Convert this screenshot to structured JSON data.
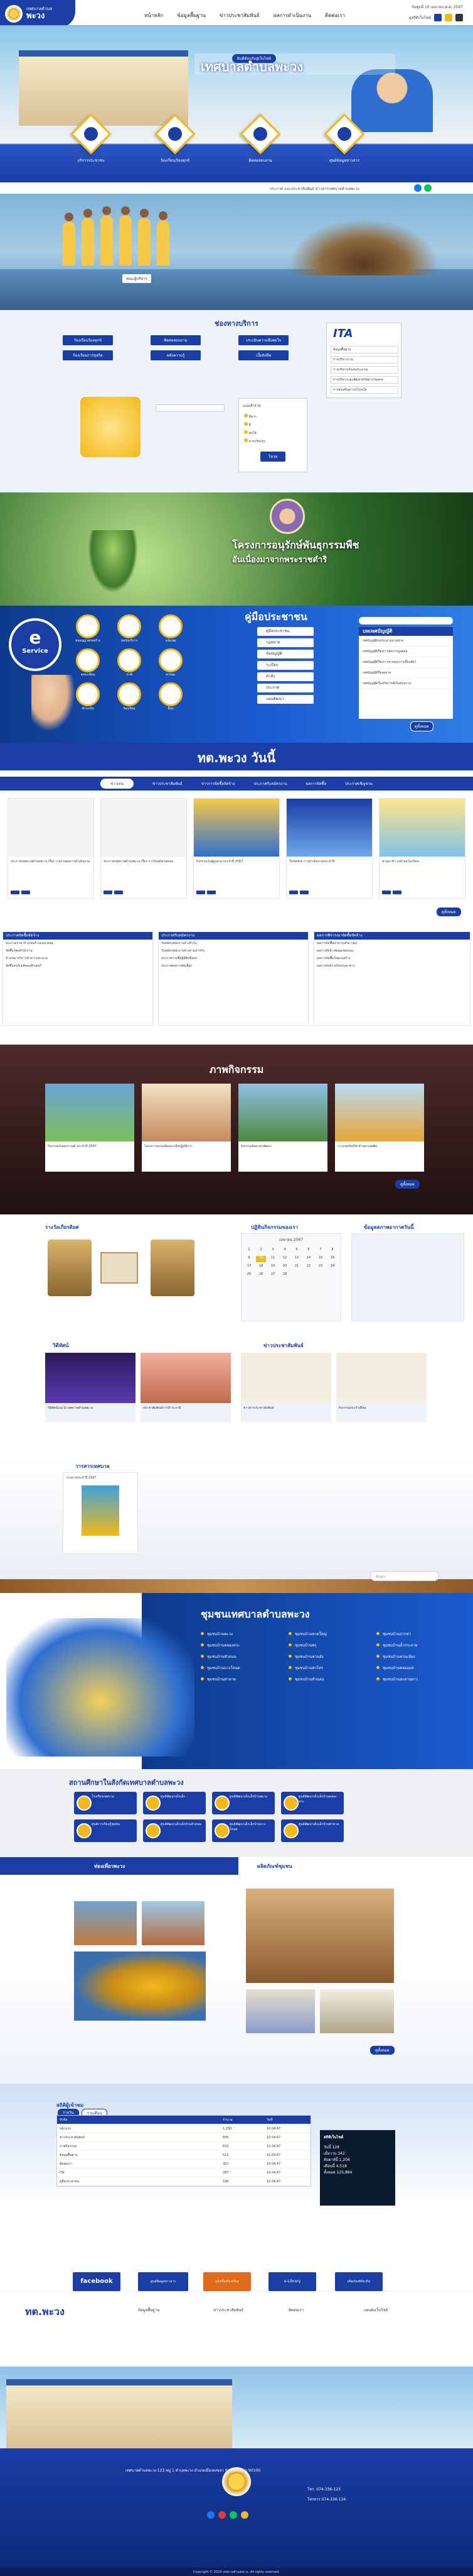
{
  "header": {
    "logo_small": "เทศบาลตำบล",
    "logo_big": "พะวง",
    "nav": [
      "หน้าหลัก",
      "ข้อมูลพื้นฐาน",
      "ข่าวประชาสัมพันธ์",
      "ผลการดำเนินงาน",
      "ติดต่อเรา"
    ],
    "top_right": "วันพุธที่ 10 เมษายน พ.ศ. 2567",
    "top_right_sub": "ดูสถิติเว็บไซต์"
  },
  "hero": {
    "badge": "ยินดีต้อนรับสู่เว็บไซต์",
    "title": "เทศบาลตำบลพะวง",
    "diamonds": [
      "บริการประชาชน",
      "ร้องเรียน/ร้องทุกข์",
      "ติดต่อสอบถาม",
      "ศูนย์ข้อมูลข่าวสาร"
    ]
  },
  "announce": {
    "text": "ประกาศ และประชาสัมพันธ์ ข่าวสารเทศบาลตำบลพะวง"
  },
  "staff_caption": "คณะผู้บริหาร",
  "services": {
    "title": "ช่องทางบริการ",
    "buttons": [
      "ร้องเรียนร้องทุกข์",
      "ติดต่อสอบถาม",
      "ประเมินความพึงพอใจ",
      "ร้องเรียนการทุจริต",
      "คลังความรู้",
      "เบี้ยยังชีพ"
    ],
    "ita_title": "ITA",
    "ita_rows": [
      "ข้อมูลพื้นฐาน",
      "การบริหารงาน",
      "การบริหารเงินงบประมาณ",
      "การบริหารและพัฒนาทรัพยากรบุคคล",
      "การส่งเสริมความโปร่งใส"
    ],
    "poll_title": "แบบสำรวจ",
    "poll_options": [
      "ดีมาก",
      "ดี",
      "พอใช้",
      "ควรปรับปรุง"
    ],
    "poll_button": "โหวต"
  },
  "king": {
    "title": "โครงการอนุรักษ์พันธุกรรมพืช",
    "subtitle": "อันเนื่องมาจากพระราชดำริ"
  },
  "eservice": {
    "badge_big": "e",
    "badge_label": "Service",
    "icons": [
      "ขออนุญาตก่อสร้าง",
      "ขอรับบริการ",
      "แจ้งเหตุ",
      "ลงทะเบียน",
      "ภาษี",
      "ค่าขยะ",
      "ชำระเงิน",
      "ร้องเรียน",
      "อื่นๆ"
    ],
    "manual_title": "คู่มือประชาชน",
    "manual_items": [
      "คู่มือประชาชน",
      "กฎหมาย",
      "ข้อบัญญัติ",
      "ระเบียบ",
      "คำสั่ง",
      "ประกาศ",
      "แผนพัฒนา"
    ],
    "law_title": "บทเทศบัญญัติ",
    "law_rows": [
      "เทศบัญญัติงบประมาณรายจ่าย",
      "เทศบัญญัติเรื่องการจัดการมูลฝอย",
      "เทศบัญญัติเรื่องการควบคุมการเลี้ยงสัตว์",
      "เทศบัญญัติเรื่องตลาด",
      "เทศบัญญัติเรื่องกิจการที่เป็นอันตราย"
    ],
    "law_more": "ดูทั้งหมด"
  },
  "today": {
    "title": "ทต.พะวง วันนี้",
    "tabs": [
      "ข่าวเด่น",
      "ข่าวประชาสัมพันธ์",
      "ข่าวการจัดซื้อจัดจ้าง",
      "ประกาศรับสมัครงาน",
      "ผลการจัดซื้อ",
      "ประกาศเชิญชวน"
    ],
    "cards": [
      "ประกาศเทศบาลตำบลพะวง เรื่อง รายงานผลการดำเนินงาน",
      "ประกาศเทศบาลตำบลพะวง เรื่อง การรับสมัครบุคคล",
      "กิจกรรมวันผู้สูงอายุ ประจำปี 2567",
      "Timeline การดำเนินงานประจำปี",
      "ชวนมาทำ ถุงผ้าลดโลกร้อน"
    ],
    "more": "ดูทั้งหมด",
    "col_titles": [
      "ประกาศจัดซื้อจัดจ้าง",
      "ประกาศรับสมัครงาน",
      "ผลการพิจารณาจัดซื้อจัดจ้าง"
    ],
    "col_rows": [
      [
        "ประกวดราคาจ้างก่อสร้างถนน คสล.",
        "จัดซื้อวัสดุสำนักงาน",
        "จ้างเหมาบริการทำความสะอาด",
        "จัดซื้อครุภัณฑ์คอมพิวเตอร์"
      ],
      [
        "รับสมัครพนักงานจ้างทั่วไป",
        "รับสมัครพนักงานจ้างตามภารกิจ",
        "ประกาศรายชื่อผู้มีสิทธิ์สอบ",
        "ประกาศผลการคัดเลือก"
      ],
      [
        "ผลการจัดซื้ออาหารเสริม (นม)",
        "ผลการจัดจ้างซ่อมแซมถนน",
        "ผลการจัดซื้อวัสดุก่อสร้าง",
        "ผลการจัดจ้างปรับปรุงอาคาร"
      ]
    ]
  },
  "activity": {
    "title": "ภาพกิจกรรม",
    "cards": [
      "กิจกรรมวันสงกรานต์ ประจำปี 2567",
      "โครงการอบรมสัมมนาเชิงปฏิบัติการ",
      "กิจกรรมจิตอาสาพัฒนา",
      "การแข่งขันกีฬาต้านยาเสพติด"
    ],
    "more": "ดูทั้งหมด"
  },
  "awards": {
    "title": "รางวัลเกียรติยศ",
    "calendar_title": "ปฏิทินกิจกรรมของเรา",
    "calendar_month": "เมษายน 2567",
    "weather_title": "ข้อมูลสภาพอากาศวันนี้"
  },
  "videos": {
    "title": "วิดีทัศน์",
    "news_title": "ข่าวประชาสัมพันธ์",
    "cards": [
      "วีดิทัศน์แนะนำเทศบาลตำบลพะวง",
      "ประชาสัมพันธ์การชำระภาษี",
      "ข่าวสารประชาสัมพันธ์",
      "กิจกรรมประจำเดือน"
    ]
  },
  "ebook": {
    "title": "วารสารเทศบาล",
    "item": "วารสารประจำปี 2567"
  },
  "search": {
    "placeholder": "ค้นหา"
  },
  "community": {
    "title": "ชุมชนเทศบาลตำบลพะวง",
    "items": [
      "ชุมชนบ้านพะวง",
      "ชุมชนบ้านคลองหวะ",
      "ชุมชนบ้านหัวถนน",
      "ชุมชนบ้านบางโหนด",
      "ชุมชนบ้านท่าหาด",
      "ชุมชนบ้านหาดใหญ่",
      "ชุมชนบ้านพรุ",
      "ชุมชนบ้านควนลัง",
      "ชุมชนบ้านท่าไทร",
      "ชุมชนบ้านหัวนอน",
      "ชุมชนบ้านปากจ่า",
      "ชุมชนบ้านน้ำกระจาย",
      "ชุมชนบ้านควนเนียง",
      "ชุมชนบ้านคลองแห",
      "ชุมชนบ้านสะพานยาว"
    ]
  },
  "schools": {
    "title": "สถานศึกษาในสังกัดเทศบาลตำบลพะวง",
    "items": [
      "โรงเรียนเทศบาล",
      "ศูนย์พัฒนาเด็กเล็ก",
      "ศูนย์พัฒนาเด็กเล็กบ้านพะวง",
      "ศูนย์พัฒนาเด็กเล็กบ้านคลองหวะ",
      "ศูนย์การเรียนรู้ชุมชน",
      "ศูนย์พัฒนาเด็กเล็กบ้านหัวถนน",
      "ศูนย์พัฒนาเด็กเล็กบ้านบางโหนด",
      "ศูนย์พัฒนาเด็กเล็กบ้านท่าหาด"
    ]
  },
  "gallery": {
    "left_title": "ท่องเที่ยวพะวง",
    "right_title": "ผลิตภัณฑ์ชุมชน",
    "more": "ดูทั้งหมด"
  },
  "stats": {
    "title": "สถิติผู้เข้าชม",
    "tabs": [
      "รายวัน",
      "รายเดือน"
    ],
    "headers": [
      "หัวข้อ",
      "จำนวน",
      "วันที่"
    ],
    "rows": [
      [
        "หน้าแรก",
        "1,250",
        "10.04.67"
      ],
      [
        "ข่าวประชาสัมพันธ์",
        "845",
        "10.04.67"
      ],
      [
        "ภาพกิจกรรม",
        "632",
        "10.04.67"
      ],
      [
        "ข้อมูลพื้นฐาน",
        "512",
        "10.04.67"
      ],
      [
        "ติดต่อเรา",
        "301",
        "10.04.67"
      ],
      [
        "ITA",
        "287",
        "10.04.67"
      ],
      [
        "คู่มือประชาชน",
        "196",
        "10.04.67"
      ]
    ],
    "counter_title": "สถิติเว็บไซต์",
    "counter_rows": [
      "วันนี้ 128",
      "เมื่อวาน 342",
      "สัปดาห์นี้ 1,204",
      "เดือนนี้ 4,518",
      "ทั้งหมด 125,884"
    ],
    "banners": [
      "facebook",
      "ศูนย์ข้อมูลข่าวสาร",
      "แจ้งเรื่องร้องเรียน",
      "e-Library",
      "ผลิตภัณฑ์ท้องถิ่น"
    ]
  },
  "footer": {
    "logo_text": "ทต.พะวง",
    "links": [
      "ข้อมูลพื้นฐาน",
      "ข่าวประชาสัมพันธ์",
      "ติดต่อเรา",
      "แผนผังเว็บไซต์"
    ],
    "address": "เทศบาลตำบลพะวง 123 หมู่ 1 ตำบลพะวง อำเภอเมืองสงขลา จังหวัดสงขลา 90100",
    "phone": "โทร. 074-336-123",
    "fax": "โทรสาร 074-336-124",
    "copyright": "Copyright © 2024 เทศบาลตำบลพะวง. All rights reserved."
  }
}
